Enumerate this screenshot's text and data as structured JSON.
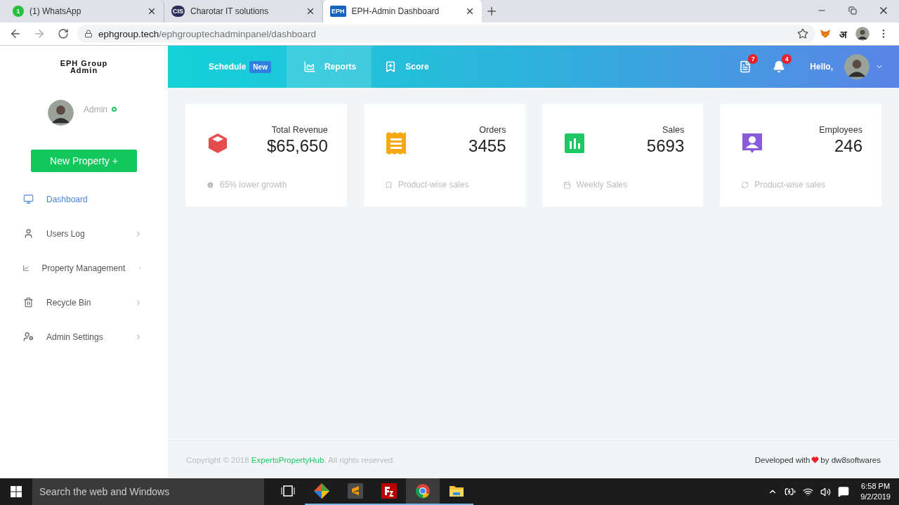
{
  "browser": {
    "tabs": [
      {
        "favicon": "1",
        "kind": "whatsapp",
        "title": "(1) WhatsApp",
        "selected": false
      },
      {
        "favicon": "CIS",
        "kind": "cis",
        "title": "Charotar IT solutions",
        "selected": false
      },
      {
        "favicon": "EPH",
        "kind": "eph",
        "title": "EPH-Admin Dashboard",
        "selected": true
      }
    ],
    "address": {
      "host": "ephgroup.tech",
      "path": "/ephgrouptechadminpanel/dashboard"
    },
    "extension_label": "अ"
  },
  "sidebar": {
    "brand": [
      "EPH Group",
      "Admin"
    ],
    "user": {
      "name": "Admin",
      "online": true
    },
    "new_button": "New Property +",
    "items": [
      {
        "label": "Dashboard",
        "kind": "monitor",
        "selected": true,
        "expandable": false
      },
      {
        "label": "Users Log",
        "kind": "user",
        "selected": false,
        "expandable": true
      },
      {
        "label": "Property Management",
        "kind": "chart",
        "selected": false,
        "expandable": true
      },
      {
        "label": "Recycle Bin",
        "kind": "trash",
        "selected": false,
        "expandable": true
      },
      {
        "label": "Admin Settings",
        "kind": "admin",
        "selected": false,
        "expandable": true
      }
    ]
  },
  "header": {
    "nav": [
      {
        "label": "Schedule",
        "badge": "New",
        "kind": "plain",
        "selected": false
      },
      {
        "label": "Reports",
        "kind": "area",
        "selected": true
      },
      {
        "label": "Score",
        "kind": "bookmark",
        "selected": false
      }
    ],
    "notifications": [
      {
        "kind": "doc",
        "count": "7"
      },
      {
        "kind": "bell",
        "count": "4"
      }
    ],
    "greeting": "Hello,"
  },
  "cards": [
    {
      "title": "Total Revenue",
      "value": "$65,650",
      "kind": "revenue",
      "color": "#e74c4c",
      "footer": "65% lower growth"
    },
    {
      "title": "Orders",
      "value": "3455",
      "kind": "orders",
      "color": "#f8a912",
      "footer": "Product-wise sales"
    },
    {
      "title": "Sales",
      "value": "5693",
      "kind": "sales",
      "color": "#1cc764",
      "footer": "Weekly Sales"
    },
    {
      "title": "Employees",
      "value": "246",
      "kind": "employees",
      "color": "#8a5cdc",
      "footer": "Product-wise sales"
    }
  ],
  "footer": {
    "copyright_before": "Copyright © 2018 ",
    "copyright_link": "ExpertsPropertyHub",
    "copyright_after": ". All rights reserved.",
    "developed_before": "Developed with",
    "developed_after": "by dw8softwares"
  },
  "taskbar": {
    "search_placeholder": "Search the web and Windows",
    "apps": [
      {
        "kind": "taskview",
        "running": false,
        "selected": false
      },
      {
        "kind": "git",
        "running": true,
        "selected": false
      },
      {
        "kind": "sublime",
        "running": true,
        "selected": false
      },
      {
        "kind": "filezilla",
        "running": true,
        "selected": false
      },
      {
        "kind": "chrome",
        "running": true,
        "selected": true
      },
      {
        "kind": "folder",
        "running": true,
        "selected": false
      }
    ],
    "time": "6:58 PM",
    "date": "9/2/2019"
  }
}
